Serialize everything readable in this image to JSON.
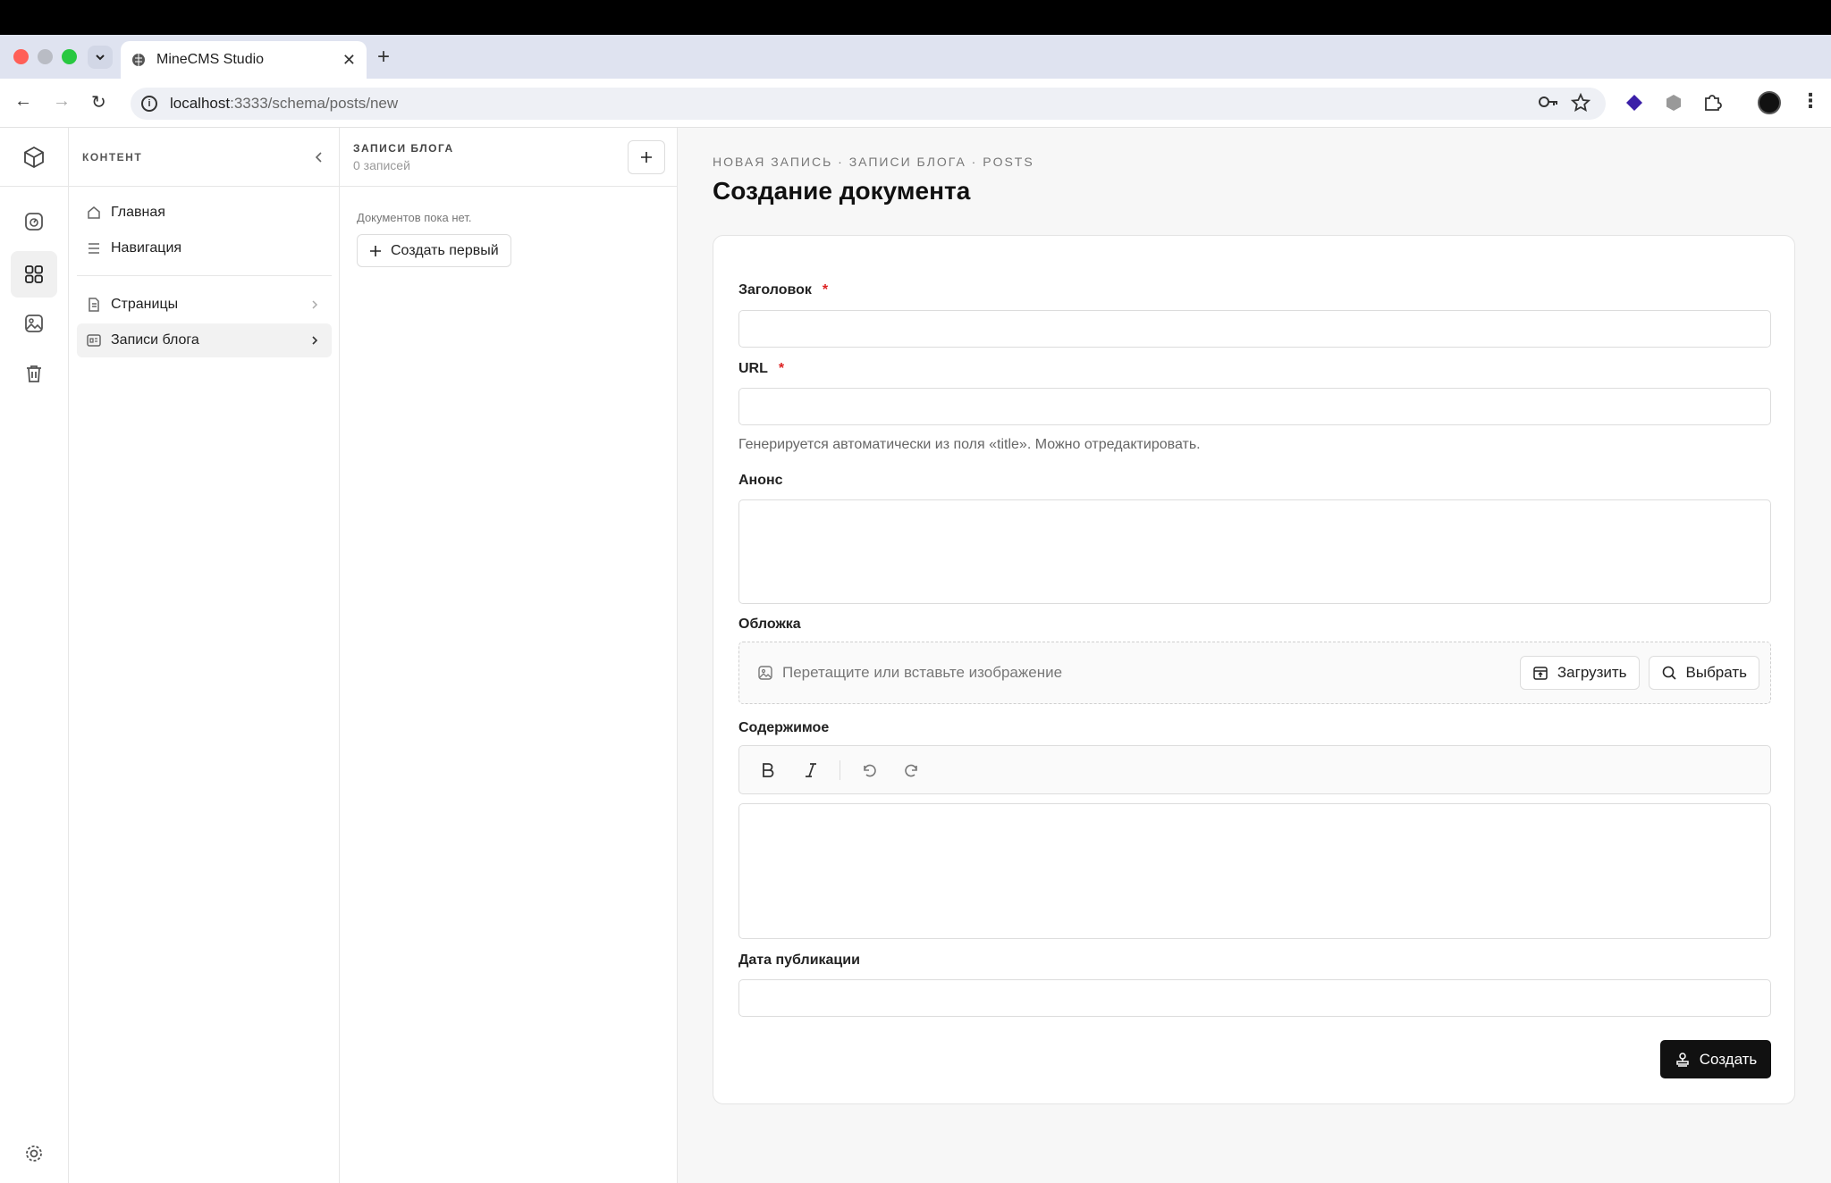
{
  "browser": {
    "tab_title": "MineCMS Studio",
    "url_host": "localhost",
    "url_rest": ":3333/schema/posts/new"
  },
  "sidebar": {
    "header": "КОНТЕНТ",
    "items": [
      {
        "label": "Главная",
        "icon": "home-icon"
      },
      {
        "label": "Навигация",
        "icon": "menu-icon"
      },
      {
        "label": "Страницы",
        "icon": "pages-icon"
      },
      {
        "label": "Записи блога",
        "icon": "blog-icon"
      }
    ]
  },
  "list": {
    "title": "ЗАПИСИ БЛОГА",
    "count": "0 записей",
    "empty_text": "Документов пока нет.",
    "create_first": "Создать первый"
  },
  "main": {
    "breadcrumb": "НОВАЯ ЗАПИСЬ · ЗАПИСИ БЛОГА · POSTS",
    "title": "Создание документа",
    "fields": {
      "title_label": "Заголовок",
      "url_label": "URL",
      "url_help": "Генерируется автоматически из поля «title». Можно отредактировать.",
      "excerpt_label": "Анонс",
      "cover_label": "Обложка",
      "cover_placeholder": "Перетащите или вставьте изображение",
      "upload_btn": "Загрузить",
      "choose_btn": "Выбрать",
      "content_label": "Содержимое",
      "date_label": "Дата публикации"
    },
    "required_mark": "*",
    "submit": "Создать"
  }
}
